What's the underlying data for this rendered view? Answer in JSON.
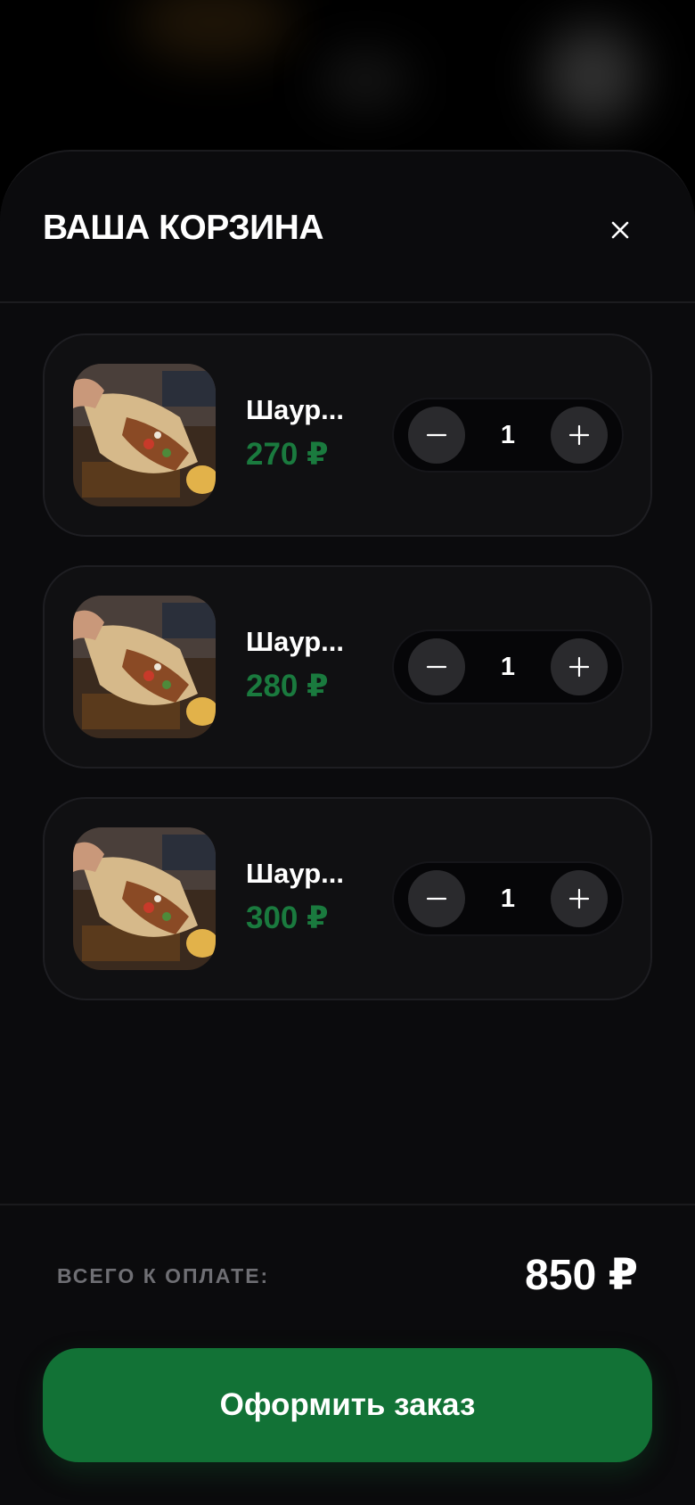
{
  "cart": {
    "title": "ВАША КОРЗИНА",
    "items": [
      {
        "name": "Шаур...",
        "price": "270 ₽",
        "quantity": "1"
      },
      {
        "name": "Шаур...",
        "price": "280 ₽",
        "quantity": "1"
      },
      {
        "name": "Шаур...",
        "price": "300 ₽",
        "quantity": "1"
      }
    ],
    "total_label": "ВСЕГО К ОПЛАТЕ:",
    "total_value": "850 ₽",
    "checkout_label": "Оформить заказ"
  },
  "icons": {
    "close": "close-icon",
    "minus": "minus-icon",
    "plus": "plus-icon"
  },
  "colors": {
    "accent": "#127236",
    "price": "#1a7a3e",
    "background": "#0b0b0d"
  }
}
